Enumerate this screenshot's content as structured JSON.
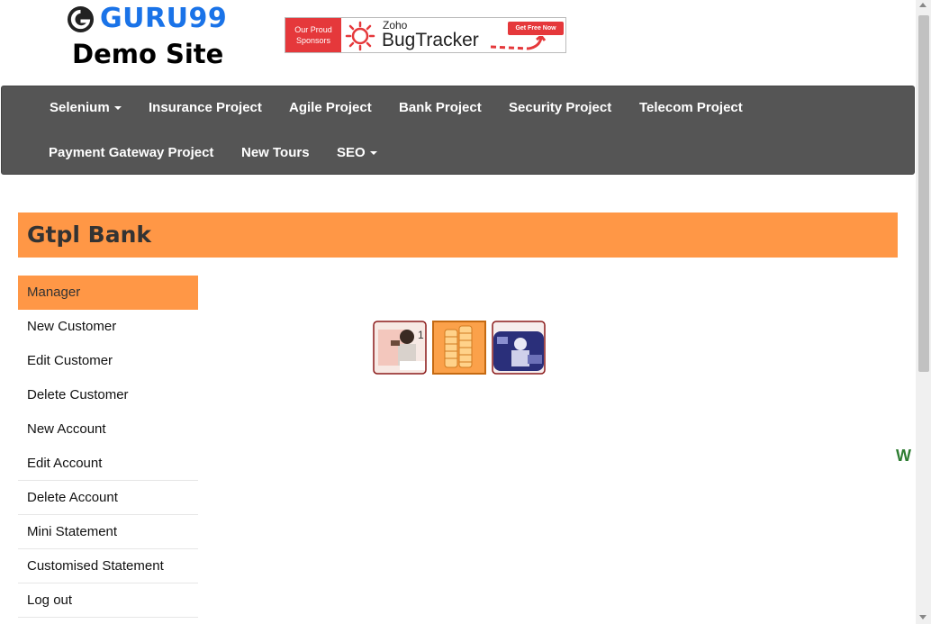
{
  "logo": {
    "brand": "GURU99",
    "subtitle": "Demo Site"
  },
  "ad": {
    "left_text_1": "Our Proud",
    "left_text_2": "Sponsors",
    "small": "Zoho",
    "product": "BugTracker",
    "cta": "Get Free Now"
  },
  "nav": {
    "row1": [
      "Selenium",
      "Insurance Project",
      "Agile Project",
      "Bank Project",
      "Security Project",
      "Telecom Project"
    ],
    "row2": [
      "Payment Gateway Project",
      "New Tours",
      "SEO"
    ]
  },
  "page": {
    "title": "Gtpl Bank",
    "welcome_fragment": "W"
  },
  "menu": {
    "items": [
      "Manager",
      "New Customer",
      "Edit Customer",
      "Delete Customer",
      "New Account",
      "Edit Account",
      "Delete Account",
      "Mini Statement",
      "Customised Statement",
      "Log out"
    ],
    "active_index": 0
  },
  "colors": {
    "accent": "#ff9746",
    "navbar": "#555555",
    "brand_blue": "#1a73e8",
    "welcome_green": "#2e7d32"
  }
}
